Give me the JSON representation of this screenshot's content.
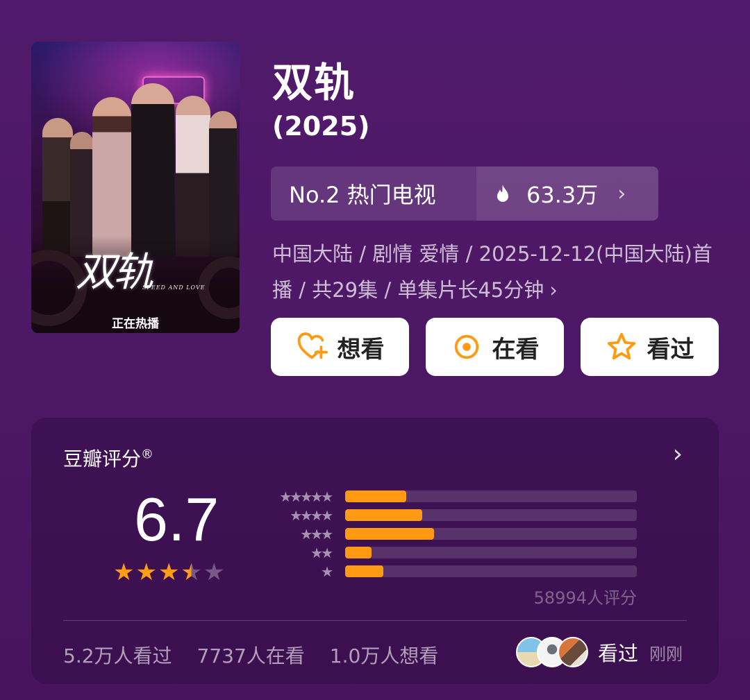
{
  "poster": {
    "logo_text": "双轨",
    "logo_subtitle": "SPEED AND LOVE",
    "status_text": "正在热播"
  },
  "title": "双轨",
  "year": "(2025)",
  "ranking": {
    "label": "No.2 热门电视",
    "heat": "63.3万",
    "chevron": "›"
  },
  "meta": {
    "line": "中国大陆 / 剧情 爱情 / 2025-12-12(中国大陆)首播 / 共29集 / 单集片长45分钟",
    "chevron": "›"
  },
  "actions": [
    {
      "label": "想看",
      "icon": "heart-plus-icon"
    },
    {
      "label": "在看",
      "icon": "target-icon"
    },
    {
      "label": "看过",
      "icon": "star-outline-icon"
    }
  ],
  "rating": {
    "title": "豆瓣评分",
    "registered_mark": "®",
    "score": "6.7",
    "stars_value": 3.5,
    "stars_max": 5,
    "distribution": [
      {
        "stars": 5,
        "fraction": 0.21
      },
      {
        "stars": 4,
        "fraction": 0.265
      },
      {
        "stars": 3,
        "fraction": 0.305
      },
      {
        "stars": 2,
        "fraction": 0.09
      },
      {
        "stars": 1,
        "fraction": 0.13
      }
    ],
    "count_text": "58994人评分"
  },
  "stats": {
    "watched": "5.2万人看过",
    "watching": "7737人在看",
    "want": "1.0万人想看"
  },
  "friends": {
    "label": "看过",
    "time": "刚刚"
  },
  "colors": {
    "background": "#4c1764",
    "accent": "#ff9a12",
    "button_bg": "#ffffff"
  }
}
